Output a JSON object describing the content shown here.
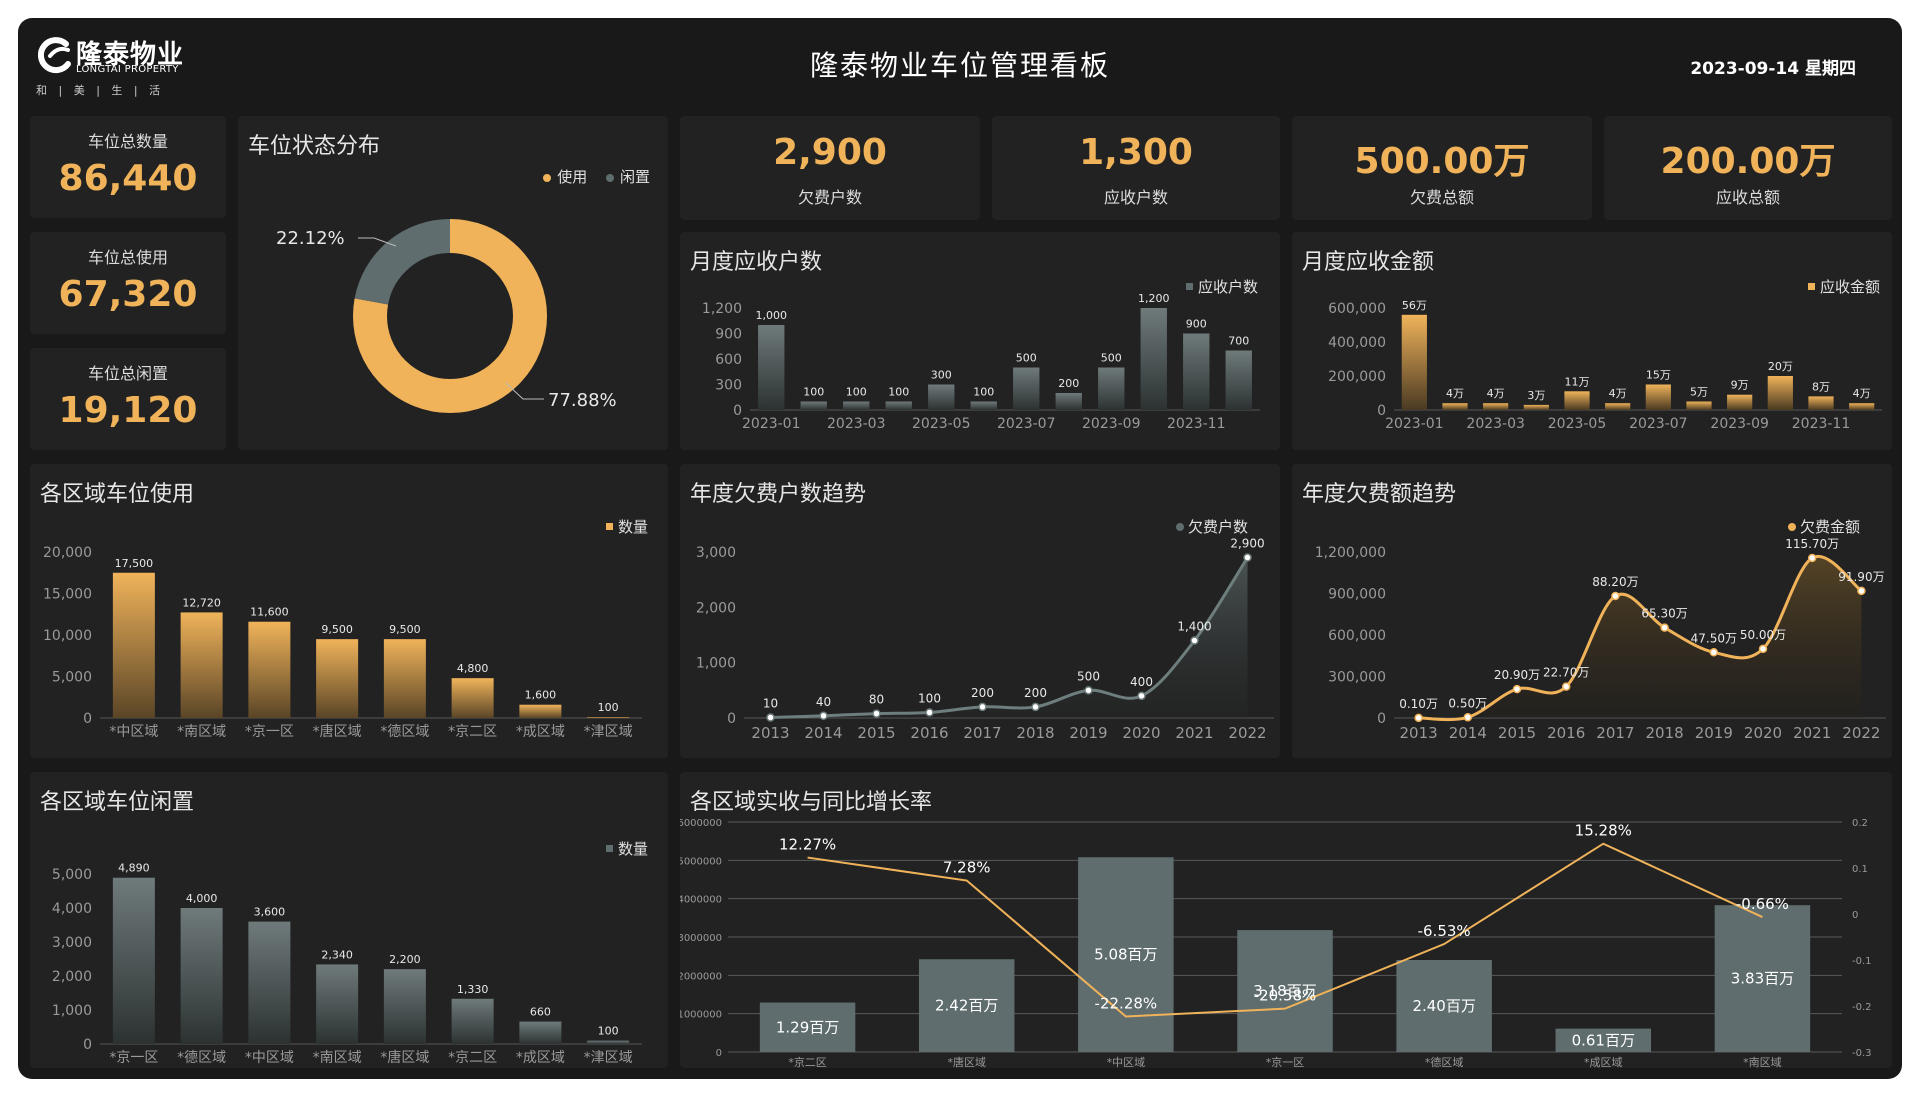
{
  "header": {
    "logo_name": "隆泰物业",
    "logo_en": "LONGTAI PROPERTY",
    "logo_motto": "和 | 美 | 生 | 活",
    "title": "隆泰物业车位管理看板",
    "date": "2023-09-14 星期四"
  },
  "colors": {
    "accent": "#f0b35a",
    "gray": "#5f6d6e",
    "panel": "#222222",
    "bg": "#191919"
  },
  "stats": [
    {
      "label": "车位总数量",
      "value": "86,440"
    },
    {
      "label": "车位总使用",
      "value": "67,320"
    },
    {
      "label": "车位总闲置",
      "value": "19,120"
    }
  ],
  "kpis": [
    {
      "value": "2,900",
      "label": "欠费户数"
    },
    {
      "value": "1,300",
      "label": "应收户数"
    },
    {
      "value": "500.00万",
      "label": "欠费总额"
    },
    {
      "value": "200.00万",
      "label": "应收总额"
    }
  ],
  "chart_data": [
    {
      "id": "status",
      "title": "车位状态分布",
      "type": "pie",
      "legend": [
        "使用",
        "闲置"
      ],
      "legend_position": "top-right",
      "slices": [
        {
          "name": "使用",
          "value": 77.88,
          "label": "77.88%",
          "color": "#f0b35a"
        },
        {
          "name": "闲置",
          "value": 22.12,
          "label": "22.12%",
          "color": "#5f6d6e"
        }
      ]
    },
    {
      "id": "monthly_households",
      "title": "月度应收户数",
      "type": "bar",
      "legend": [
        "应收户数"
      ],
      "legend_position": "top-right",
      "categories": [
        "2023-01",
        "2023-02",
        "2023-03",
        "2023-04",
        "2023-05",
        "2023-06",
        "2023-07",
        "2023-08",
        "2023-09",
        "2023-10",
        "2023-11",
        "2023-12"
      ],
      "tick_labels": [
        "2023-01",
        "2023-03",
        "2023-05",
        "2023-07",
        "2023-09",
        "2023-11"
      ],
      "values": [
        1000,
        100,
        100,
        100,
        300,
        100,
        500,
        200,
        500,
        1200,
        900,
        700
      ],
      "labels": [
        "1,000",
        "100",
        "100",
        "100",
        "300",
        "100",
        "500",
        "200",
        "500",
        "1,200",
        "900",
        "700"
      ],
      "ylim": [
        0,
        1200
      ],
      "yticks": [
        "0",
        "300",
        "600",
        "900",
        "1,200"
      ],
      "grid": false
    },
    {
      "id": "monthly_amount",
      "title": "月度应收金额",
      "type": "bar",
      "legend": [
        "应收金额"
      ],
      "legend_position": "top-right",
      "categories": [
        "2023-01",
        "2023-02",
        "2023-03",
        "2023-04",
        "2023-05",
        "2023-06",
        "2023-07",
        "2023-08",
        "2023-09",
        "2023-10",
        "2023-11",
        "2023-12"
      ],
      "tick_labels": [
        "2023-01",
        "2023-03",
        "2023-05",
        "2023-07",
        "2023-09",
        "2023-11"
      ],
      "values": [
        560000,
        40000,
        40000,
        30000,
        110000,
        40000,
        150000,
        50000,
        90000,
        200000,
        80000,
        40000
      ],
      "labels": [
        "56万",
        "4万",
        "4万",
        "3万",
        "11万",
        "4万",
        "15万",
        "5万",
        "9万",
        "20万",
        "8万",
        "4万"
      ],
      "ylim": [
        0,
        600000
      ],
      "yticks": [
        "0",
        "200,000",
        "400,000",
        "600,000"
      ],
      "grid": false
    },
    {
      "id": "region_usage",
      "title": "各区域车位使用",
      "type": "bar",
      "legend": [
        "数量"
      ],
      "legend_position": "top-right",
      "categories": [
        "*中区域",
        "*南区域",
        "*京一区",
        "*唐区域",
        "*德区域",
        "*京二区",
        "*成区域",
        "*津区域"
      ],
      "values": [
        17500,
        12720,
        11600,
        9500,
        9500,
        4800,
        1600,
        100
      ],
      "labels": [
        "17,500",
        "12,720",
        "11,600",
        "9,500",
        "9,500",
        "4,800",
        "1,600",
        "100"
      ],
      "ylim": [
        0,
        20000
      ],
      "yticks": [
        "0",
        "5,000",
        "10,000",
        "15,000",
        "20,000"
      ],
      "grid": false
    },
    {
      "id": "yearly_households",
      "title": "年度欠费户数趋势",
      "type": "area",
      "legend": [
        "欠费户数"
      ],
      "legend_position": "top-right",
      "x": [
        "2013",
        "2014",
        "2015",
        "2016",
        "2017",
        "2018",
        "2019",
        "2020",
        "2021",
        "2022"
      ],
      "values": [
        10,
        40,
        80,
        100,
        200,
        200,
        500,
        400,
        1400,
        2900
      ],
      "labels": [
        "10",
        "40",
        "80",
        "100",
        "200",
        "200",
        "500",
        "400",
        "1,400",
        "2,900"
      ],
      "ylim": [
        0,
        3000
      ],
      "yticks": [
        "0",
        "1,000",
        "2,000",
        "3,000"
      ],
      "grid": false
    },
    {
      "id": "yearly_amount",
      "title": "年度欠费额趋势",
      "type": "area",
      "legend": [
        "欠费金额"
      ],
      "legend_position": "top-right",
      "x": [
        "2013",
        "2014",
        "2015",
        "2016",
        "2017",
        "2018",
        "2019",
        "2020",
        "2021",
        "2022"
      ],
      "values": [
        1000,
        5000,
        209000,
        227000,
        882000,
        653000,
        475000,
        500000,
        1157000,
        919000
      ],
      "labels": [
        "0.10万",
        "0.50万",
        "20.90万",
        "22.70万",
        "88.20万",
        "65.30万",
        "47.50万",
        "50.00万",
        "115.70万",
        "91.90万"
      ],
      "ylim": [
        0,
        1200000
      ],
      "yticks": [
        "0",
        "300,000",
        "600,000",
        "900,000",
        "1,200,000"
      ],
      "grid": false
    },
    {
      "id": "region_idle",
      "title": "各区域车位闲置",
      "type": "bar",
      "legend": [
        "数量"
      ],
      "legend_position": "top-right",
      "categories": [
        "*京一区",
        "*德区域",
        "*中区域",
        "*南区域",
        "*唐区域",
        "*京二区",
        "*成区域",
        "*津区域"
      ],
      "values": [
        4890,
        4000,
        3600,
        2340,
        2200,
        1330,
        660,
        100
      ],
      "labels": [
        "4,890",
        "4,000",
        "3,600",
        "2,340",
        "2,200",
        "1,330",
        "660",
        "100"
      ],
      "ylim": [
        0,
        5000
      ],
      "yticks": [
        "0",
        "1,000",
        "2,000",
        "3,000",
        "4,000",
        "5,000"
      ],
      "grid": false
    },
    {
      "id": "region_collection",
      "title": "各区域实收与同比增长率",
      "type": "bar",
      "categories": [
        "*京二区",
        "*唐区域",
        "*中区域",
        "*京一区",
        "*德区域",
        "*成区域",
        "*南区域"
      ],
      "series": [
        {
          "values": [
            1290000,
            2420000,
            5080000,
            3180000,
            2400000,
            610000,
            3830000
          ],
          "labels": [
            "1.29百万",
            "2.42百万",
            "5.08百万",
            "3.18百万",
            "2.40百万",
            "0.61百万",
            "3.83百万"
          ]
        },
        {
          "values": [
            0.1227,
            0.0728,
            -0.2228,
            -0.2058,
            -0.0653,
            0.1528,
            -0.0066
          ],
          "labels": [
            "12.27%",
            "7.28%",
            "-22.28%",
            "-20.58%",
            "-6.53%",
            "15.28%",
            "-0.66%"
          ]
        }
      ],
      "ylim": [
        0,
        6000000
      ],
      "y2lim": [
        -0.3,
        0.2
      ],
      "yticks": [
        "0",
        "1000000",
        "2000000",
        "3000000",
        "4000000",
        "5000000",
        "6000000"
      ],
      "y2ticks": [
        "-0.3",
        "-0.2",
        "-0.1",
        "0",
        "0.1",
        "0.2"
      ],
      "grid": true
    }
  ]
}
